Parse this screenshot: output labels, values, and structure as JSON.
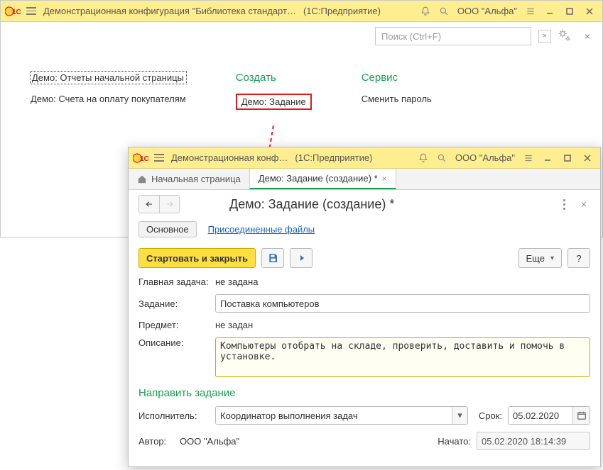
{
  "main_window": {
    "title_left": "Демонстрационная конфигурация \"Библиотека стандарт…",
    "title_right": "(1С:Предприятие)",
    "org": "ООО \"Альфа\"",
    "search_placeholder": "Поиск (Ctrl+F)"
  },
  "start_page": {
    "reports_link": "Демо: Отчеты начальной страницы",
    "invoices_link": "Демо: Счета на оплату покупателям",
    "create_heading": "Создать",
    "task_link": "Демо: Задание",
    "service_heading": "Сервис",
    "change_password_link": "Сменить пароль"
  },
  "sub_window": {
    "title_left": "Демонстрационная конф…",
    "title_right": "(1С:Предприятие)",
    "org": "ООО \"Альфа\"",
    "tab_home": "Начальная страница",
    "tab_task": "Демо: Задание (создание) *",
    "form_title": "Демо: Задание (создание) *",
    "sec_main": "Основное",
    "sec_files": "Присоединенные файлы",
    "btn_start_close": "Стартовать и закрыть",
    "btn_more": "Еще",
    "btn_help": "?",
    "labels": {
      "main_task": "Главная задача:",
      "main_task_v": "не задана",
      "task": "Задание:",
      "subject": "Предмет:",
      "subject_v": "не задан",
      "descr": "Описание:",
      "assign_heading": "Направить задание",
      "executor": "Исполнитель:",
      "deadline": "Срок:",
      "author": "Автор:",
      "author_v": "ООО \"Альфа\"",
      "started": "Начато:"
    },
    "values": {
      "task_name": "Поставка компьютеров",
      "description": "Компьютеры отобрать на складе, проверить, доставить и помочь в установке.",
      "executor": "Координатор выполнения задач",
      "deadline": "05.02.2020",
      "started": "05.02.2020 18:14:39"
    }
  }
}
